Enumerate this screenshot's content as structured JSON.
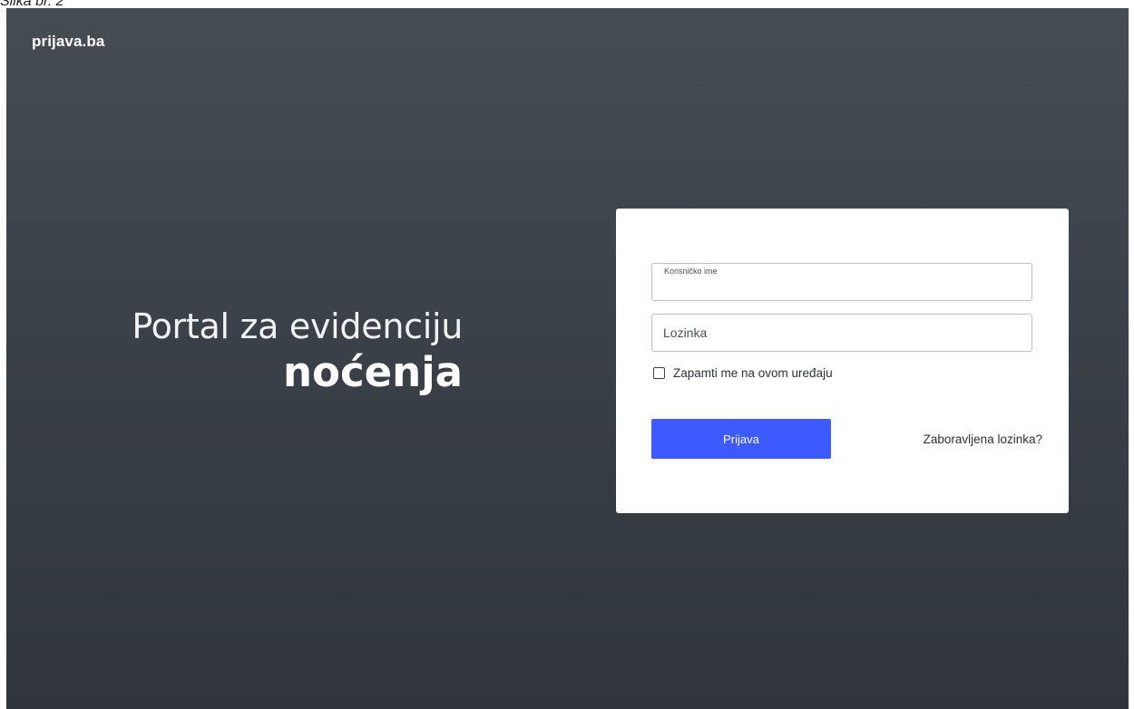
{
  "caption": "Slika br. 2",
  "brand": "prijava.ba",
  "hero": {
    "line1": "Portal za evidenciju",
    "line2": "noćenja"
  },
  "login": {
    "username_label": "Korisničko ime",
    "username_value": "",
    "password_placeholder": "Lozinka",
    "password_value": "",
    "remember_label": "Zapamti me na ovom uređaju",
    "remember_checked": false,
    "submit_label": "Prijava",
    "forgot_label": "Zaboravljena lozinka?"
  },
  "colors": {
    "background_top": "#454c52",
    "background_bottom": "#2f353b",
    "primary_button": "#3d5afe",
    "card": "#ffffff"
  }
}
